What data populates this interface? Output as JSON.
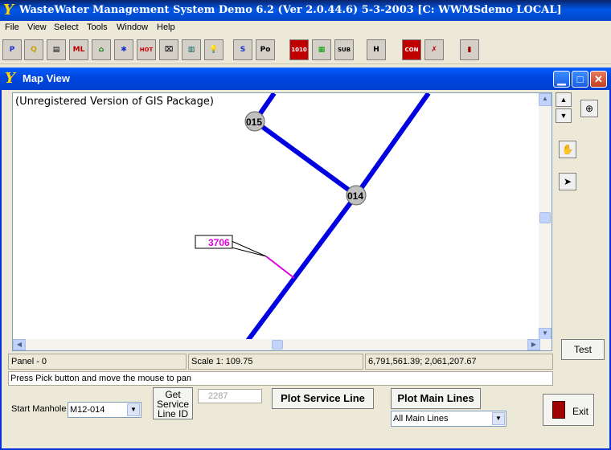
{
  "app": {
    "title": "WasteWater Management System Demo 6.2  (Ver 2.0.44.6)   5-3-2003   [C:  WWMSdemo  LOCAL]",
    "icon_glyph": "Y"
  },
  "menu": {
    "items": [
      "File",
      "View",
      "Select",
      "Tools",
      "Window",
      "Help"
    ]
  },
  "toolbar": {
    "buttons": [
      {
        "name": "p-tool-icon",
        "glyph": "P",
        "color": "#1a2fd0"
      },
      {
        "name": "lookup-tool-icon",
        "glyph": "Q",
        "color": "#c8a000"
      },
      {
        "name": "manhole-tool-icon",
        "glyph": "▤",
        "color": "#000000"
      },
      {
        "name": "main-line-tool-icon",
        "glyph": "ML",
        "color": "#c00000"
      },
      {
        "name": "houses-tool-icon",
        "glyph": "⌂",
        "color": "#008000"
      },
      {
        "name": "network-tool-icon",
        "glyph": "✱",
        "color": "#1a2fd0"
      },
      {
        "name": "hotspot-tool-icon",
        "glyph": "HOT",
        "color": "#d00000"
      },
      {
        "name": "camera-tool-icon",
        "glyph": "⌧",
        "color": "#000000"
      },
      {
        "name": "plant-tool-icon",
        "glyph": "▥",
        "color": "#006060"
      },
      {
        "name": "lightbulb-tool-icon",
        "glyph": "💡",
        "color": "#d0a000"
      },
      {
        "name": "service-tool-icon",
        "glyph": "S",
        "color": "#1a2fd0"
      },
      {
        "name": "po-tool-icon",
        "glyph": "Po",
        "color": "#000000"
      },
      {
        "name": "binary-tool-icon",
        "glyph": "1010",
        "color": "#ffffff"
      },
      {
        "name": "display-tool-icon",
        "glyph": "▦",
        "color": "#00a000"
      },
      {
        "name": "subdiv-tool-icon",
        "glyph": "SUB",
        "color": "#000000"
      },
      {
        "name": "junction-tool-icon",
        "glyph": "H",
        "color": "#000000"
      },
      {
        "name": "contrib-tool-icon",
        "glyph": "CON",
        "color": "#ffffff"
      },
      {
        "name": "person-tool-icon",
        "glyph": "✗",
        "color": "#c00000"
      },
      {
        "name": "exit-door-tool-icon",
        "glyph": "▮",
        "color": "#a00000"
      }
    ]
  },
  "map_window": {
    "title": "Map View",
    "minimize_glyph": "▁",
    "maximize_glyph": "□",
    "close_glyph": "✕",
    "watermark": "(Unregistered Version of GIS Package)",
    "manholes": [
      {
        "label": "015"
      },
      {
        "label": "014"
      }
    ],
    "service_tag": "3706",
    "colors": {
      "main_line": "#0000e0",
      "service_line": "#e000e0",
      "manhole_fill": "#c0c0c0"
    }
  },
  "side_tools": {
    "up_glyph": "▲",
    "down_glyph": "▼",
    "zoom_glyph": "⊕",
    "pan_glyph": "✋",
    "pick_glyph": "➤",
    "test_label": "Test"
  },
  "status": {
    "panel": "Panel - 0",
    "scale": "Scale 1: 109.75",
    "coords": "6,791,561.39; 2,061,207.67",
    "message": "Press Pick button and move the mouse to pan"
  },
  "controls": {
    "start_manhole_label": "Start Manhole",
    "start_manhole_value": "M12-014",
    "get_service_label": "Get Service Line ID",
    "service_id_value": "2287",
    "plot_service_label": "Plot Service Line",
    "plot_main_label": "Plot Main Lines",
    "main_lines_value": "All Main Lines",
    "exit_label": "Exit",
    "caret_glyph": "▼"
  }
}
